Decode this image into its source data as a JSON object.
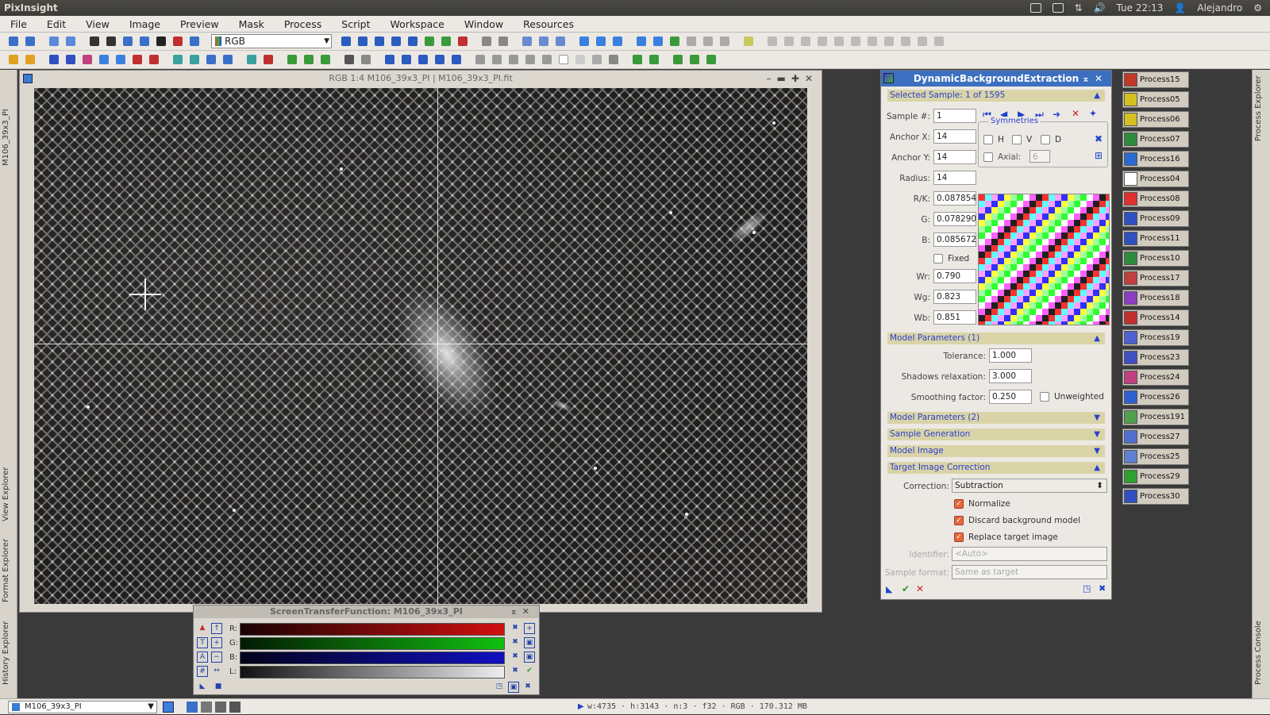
{
  "app": {
    "name": "PixInsight"
  },
  "tray": {
    "time": "Tue 22:13",
    "user": "Alejandro"
  },
  "menu": [
    "File",
    "Edit",
    "View",
    "Image",
    "Preview",
    "Mask",
    "Process",
    "Script",
    "Workspace",
    "Window",
    "Resources"
  ],
  "toolbar": {
    "channel_combo": "RGB"
  },
  "left_tabs": [
    "M106_39x3_PI",
    "View Explorer",
    "Format Explorer",
    "History Explorer"
  ],
  "right_tabs": [
    "Process Explorer",
    "Process Console"
  ],
  "image_window": {
    "title": "RGB 1:4 M106_39x3_PI | M106_39x3_PI.fit"
  },
  "dbe": {
    "title": "DynamicBackgroundExtraction",
    "selected_sample": "Selected Sample: 1 of 1595",
    "sample_label": "Sample #:",
    "sample_value": "1",
    "anchor_x_label": "Anchor X:",
    "anchor_x": "14",
    "anchor_y_label": "Anchor Y:",
    "anchor_y": "14",
    "radius_label": "Radius:",
    "radius": "14",
    "rk_label": "R/K:",
    "rk": "0.087854",
    "g_label": "G:",
    "g": "0.078290",
    "b_label": "B:",
    "b": "0.085672",
    "fixed_label": "Fixed",
    "wr_label": "Wr:",
    "wr": "0.790",
    "wg_label": "Wg:",
    "wg": "0.823",
    "wb_label": "Wb:",
    "wb": "0.851",
    "symmetries": "Symmetries",
    "sym_h": "H",
    "sym_v": "V",
    "sym_d": "D",
    "axial_label": "Axial:",
    "axial_value": "6",
    "model_params_1": "Model Parameters (1)",
    "tolerance_label": "Tolerance:",
    "tolerance": "1.000",
    "shadows_label": "Shadows relaxation:",
    "shadows": "3.000",
    "smoothing_label": "Smoothing factor:",
    "smoothing": "0.250",
    "unweighted_label": "Unweighted",
    "model_params_2": "Model Parameters (2)",
    "sample_generation": "Sample Generation",
    "model_image": "Model Image",
    "target_correction": "Target Image Correction",
    "correction_label": "Correction:",
    "correction": "Subtraction",
    "normalize": "Normalize",
    "discard": "Discard background model",
    "replace": "Replace target image",
    "identifier_label": "Identifier:",
    "identifier_placeholder": "<Auto>",
    "sample_format_label": "Sample format:",
    "sample_format": "Same as target"
  },
  "processes": [
    {
      "label": "Process15",
      "color": "#c0392b"
    },
    {
      "label": "Process05",
      "color": "#d4c020"
    },
    {
      "label": "Process06",
      "color": "#d4c020"
    },
    {
      "label": "Process07",
      "color": "#2d8a3e"
    },
    {
      "label": "Process16",
      "color": "#2d6ad0"
    },
    {
      "label": "Process04",
      "color": "#ffffff"
    },
    {
      "label": "Process08",
      "color": "#e03030"
    },
    {
      "label": "Process09",
      "color": "#3050c0"
    },
    {
      "label": "Process11",
      "color": "#3050c0"
    },
    {
      "label": "Process10",
      "color": "#2d8a3e"
    },
    {
      "label": "Process17",
      "color": "#c04040"
    },
    {
      "label": "Process18",
      "color": "#8a3ec0"
    },
    {
      "label": "Process14",
      "color": "#c03030"
    },
    {
      "label": "Process19",
      "color": "#5060d0"
    },
    {
      "label": "Process23",
      "color": "#4050c0"
    },
    {
      "label": "Process24",
      "color": "#c04080"
    },
    {
      "label": "Process26",
      "color": "#3060d0"
    },
    {
      "label": "Process191",
      "color": "#50a050"
    },
    {
      "label": "Process27",
      "color": "#5070d0"
    },
    {
      "label": "Process25",
      "color": "#6080d0"
    },
    {
      "label": "Process29",
      "color": "#30a030"
    },
    {
      "label": "Process30",
      "color": "#3050c0"
    }
  ],
  "stf": {
    "title": "ScreenTransferFunction: M106_39x3_PI",
    "channels": [
      "R:",
      "G:",
      "B:",
      "L:"
    ],
    "colors": {
      "r": "#d01010",
      "g": "#10c010",
      "b": "#1010c0",
      "l": "#cccccc"
    }
  },
  "status": {
    "view": "M106_39x3_PI",
    "info": "w:4735 · h:3143 · n:3 · f32 · RGB · 170.312 MB"
  }
}
